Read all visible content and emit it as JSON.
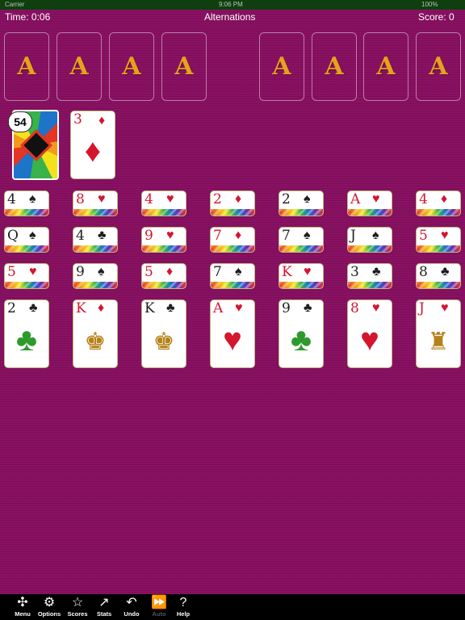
{
  "status": {
    "carrier": "Carrier",
    "time": "9:06 PM",
    "battery": "100%"
  },
  "game": {
    "time": "Time: 0:06",
    "title": "Alternations",
    "score": "Score: 0"
  },
  "foundations": [
    "A",
    "A",
    "A",
    "A",
    "A",
    "A",
    "A",
    "A"
  ],
  "stock": {
    "count": "54"
  },
  "waste": {
    "rank": "3",
    "suit": "♦"
  },
  "tableau": [
    {
      "peeks": [
        {
          "rank": "4",
          "suit": "♠"
        },
        {
          "rank": "Q",
          "suit": "♠"
        },
        {
          "rank": "5",
          "suit": "♥"
        }
      ],
      "top": {
        "rank": "2",
        "suit": "♣",
        "art": "♣"
      }
    },
    {
      "peeks": [
        {
          "rank": "8",
          "suit": "♥"
        },
        {
          "rank": "4",
          "suit": "♣"
        },
        {
          "rank": "9",
          "suit": "♠"
        }
      ],
      "top": {
        "rank": "K",
        "suit": "♦",
        "art": "♚"
      }
    },
    {
      "peeks": [
        {
          "rank": "4",
          "suit": "♥"
        },
        {
          "rank": "9",
          "suit": "♥"
        },
        {
          "rank": "5",
          "suit": "♦"
        }
      ],
      "top": {
        "rank": "K",
        "suit": "♣",
        "art": "♚"
      }
    },
    {
      "peeks": [
        {
          "rank": "2",
          "suit": "♦"
        },
        {
          "rank": "7",
          "suit": "♦"
        },
        {
          "rank": "7",
          "suit": "♠"
        }
      ],
      "top": {
        "rank": "A",
        "suit": "♥",
        "art": "♥"
      }
    },
    {
      "peeks": [
        {
          "rank": "2",
          "suit": "♠"
        },
        {
          "rank": "7",
          "suit": "♠"
        },
        {
          "rank": "K",
          "suit": "♥"
        }
      ],
      "top": {
        "rank": "9",
        "suit": "♣",
        "art": "♣"
      }
    },
    {
      "peeks": [
        {
          "rank": "A",
          "suit": "♥"
        },
        {
          "rank": "J",
          "suit": "♠"
        },
        {
          "rank": "3",
          "suit": "♣"
        }
      ],
      "top": {
        "rank": "8",
        "suit": "♥",
        "art": "♥"
      }
    },
    {
      "peeks": [
        {
          "rank": "4",
          "suit": "♦"
        },
        {
          "rank": "5",
          "suit": "♥"
        },
        {
          "rank": "8",
          "suit": "♣"
        }
      ],
      "top": {
        "rank": "J",
        "suit": "♥",
        "art": "♜"
      }
    }
  ],
  "toolbar": [
    {
      "label": "Menu",
      "icon": "✣"
    },
    {
      "label": "Options",
      "icon": "⚙"
    },
    {
      "label": "Scores",
      "icon": "☆"
    },
    {
      "label": "Stats",
      "icon": "↗"
    },
    {
      "label": "Undo",
      "icon": "↶"
    },
    {
      "label": "Auto",
      "icon": "⏩"
    },
    {
      "label": "Help",
      "icon": "?"
    }
  ]
}
